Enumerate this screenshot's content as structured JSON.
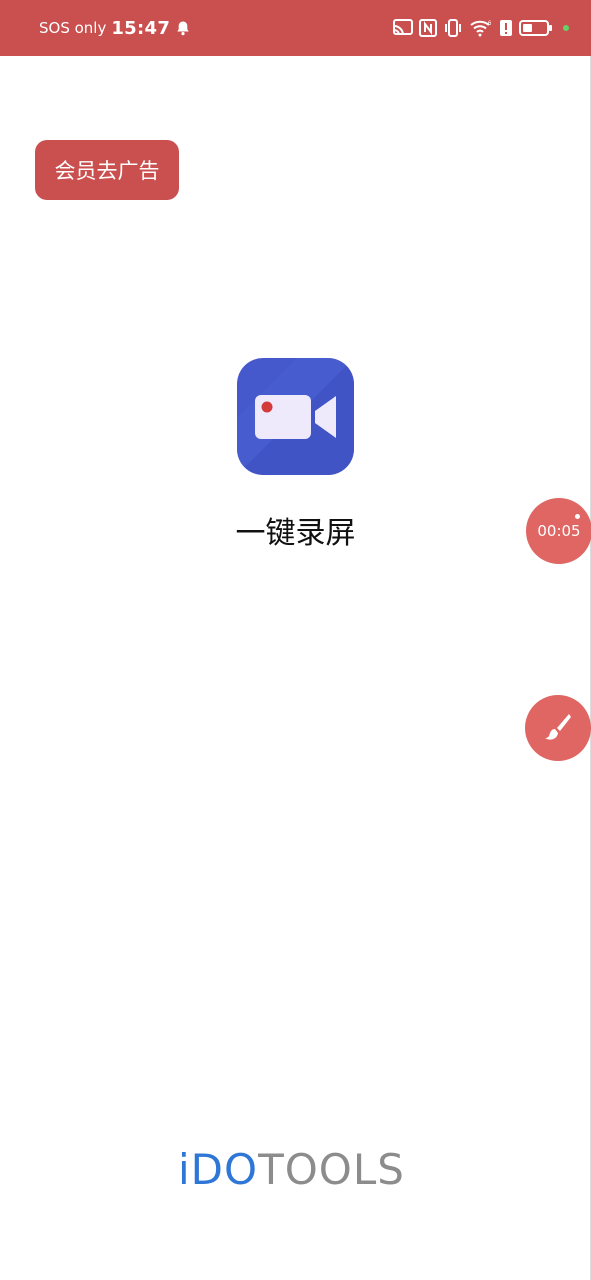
{
  "status_bar": {
    "carrier": "SOS only",
    "time": "15:47",
    "icons": [
      "bell-icon",
      "cast-icon",
      "nfc-icon",
      "vibrate-icon",
      "wifi-icon",
      "alert-icon",
      "battery-icon",
      "indicator-dot"
    ],
    "bg_color": "#c9504f"
  },
  "vip_button": {
    "label": "会员去广告"
  },
  "app": {
    "title": "一键录屏",
    "icon": "video-camera-icon",
    "icon_color": "#4559cc"
  },
  "floating": {
    "timer_text": "00:05",
    "brush_icon": "brush-icon",
    "accent": "#e06664"
  },
  "brand": {
    "part1": "iDO",
    "part2": "TOOLS",
    "blue": "#2f77d6",
    "gray": "#8c8c8c"
  }
}
